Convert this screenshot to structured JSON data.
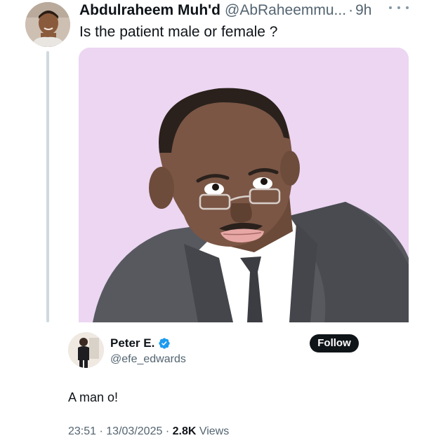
{
  "tweet": {
    "display_name": "Abdulraheem Muh'd",
    "handle": "@AbRaheemmu...",
    "separator": "·",
    "time_ago": "9h",
    "text": "Is the patient male or female ?",
    "more_icon": "more-horizontal-icon",
    "media_icon": "cartoon-image"
  },
  "reply": {
    "display_name": "Peter E.",
    "verified_icon": "verified-badge-icon",
    "handle": "@efe_edwards",
    "follow_label": "Follow",
    "text": "A man o!",
    "time": "23:51",
    "date": "13/03/2025",
    "separator": "·",
    "views_count": "2.8K",
    "views_label": "Views"
  },
  "colors": {
    "accent_blue": "#1d9bf0",
    "text_primary": "#0f1419",
    "text_secondary": "#536471",
    "thread_line": "#cfd9de",
    "media_background": "#ecd6f2"
  }
}
